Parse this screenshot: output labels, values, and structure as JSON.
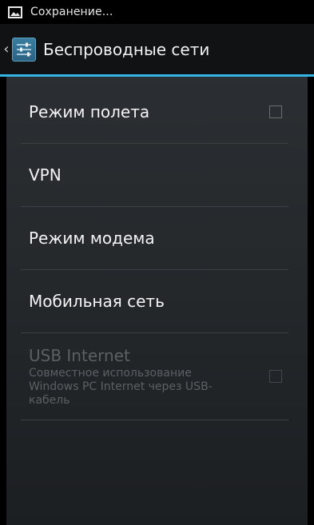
{
  "status_bar": {
    "notification_icon": "picture-icon",
    "text": "Сохранение..."
  },
  "action_bar": {
    "back_icon": "chevron-left-icon",
    "app_icon": "settings-sliders-icon",
    "title": "Беспроводные сети",
    "accent_color": "#33b5e5"
  },
  "preferences": [
    {
      "title": "Режим полета",
      "has_checkbox": true,
      "checked": false,
      "enabled": true
    },
    {
      "title": "VPN",
      "has_checkbox": false,
      "enabled": true
    },
    {
      "title": "Режим модема",
      "has_checkbox": false,
      "enabled": true
    },
    {
      "title": "Мобильная сеть",
      "has_checkbox": false,
      "enabled": true
    },
    {
      "title": "USB Internet",
      "summary": "Совместное использование Windows PC Internet через USB-кабель",
      "has_checkbox": true,
      "checked": false,
      "enabled": false
    }
  ]
}
